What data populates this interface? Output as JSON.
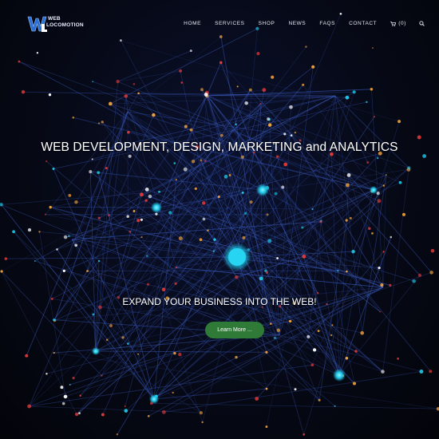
{
  "brand": {
    "logo_line1": "WEB",
    "logo_line2": "LOCOMOTION"
  },
  "nav": {
    "items": [
      {
        "label": "HOME",
        "name": "nav-home"
      },
      {
        "label": "SERVICES",
        "name": "nav-services"
      },
      {
        "label": "SHOP",
        "name": "nav-shop"
      },
      {
        "label": "NEWS",
        "name": "nav-news"
      },
      {
        "label": "FAQS",
        "name": "nav-faqs"
      },
      {
        "label": "CONTACT",
        "name": "nav-contact"
      }
    ],
    "cart_label": "(0)",
    "cart_icon": "cart-icon",
    "search_icon": "search-icon"
  },
  "hero": {
    "headline": "WEB DEVELOPMENT, DESIGN, MARKETING and ANALYTICS",
    "subheadline": "EXPAND YOUR BUSINESS INTO THE WEB!",
    "cta_label": "Learn More ..."
  },
  "colors": {
    "background": "#05070f",
    "network_lines": "#3b5bbf",
    "node_cyan": "#1fc9e8",
    "node_red": "#e23a3a",
    "node_orange": "#f2a23a",
    "node_white": "#ffffff",
    "cta_green": "#2f7a36",
    "logo_blue": "#2a6fd6"
  }
}
